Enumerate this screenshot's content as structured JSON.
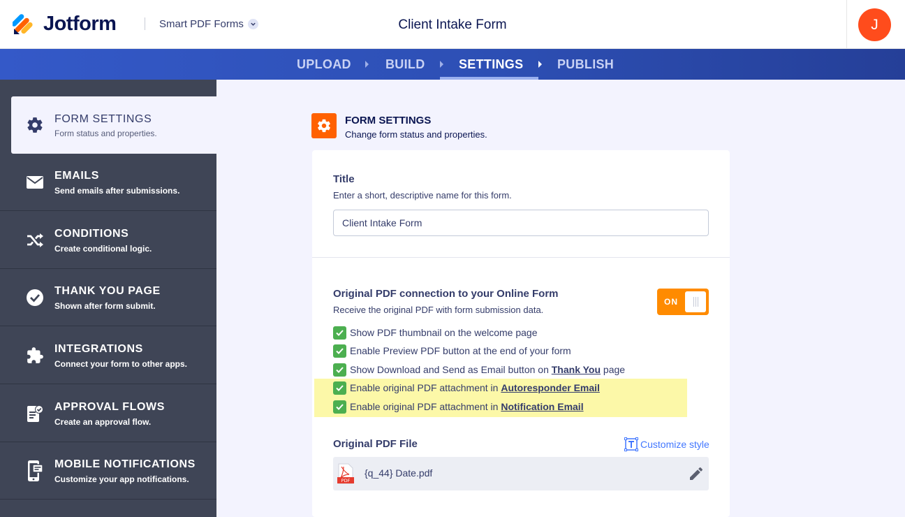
{
  "header": {
    "logo_text": "Jotform",
    "product_label": "Smart PDF Forms",
    "form_title": "Client Intake Form",
    "avatar_initial": "J"
  },
  "nav": {
    "steps": [
      "UPLOAD",
      "BUILD",
      "SETTINGS",
      "PUBLISH"
    ],
    "active": "SETTINGS"
  },
  "sidebar": {
    "items": [
      {
        "title": "FORM SETTINGS",
        "subtitle": "Form status and properties.",
        "icon": "gear-icon"
      },
      {
        "title": "EMAILS",
        "subtitle": "Send emails after submissions.",
        "icon": "envelope-icon"
      },
      {
        "title": "CONDITIONS",
        "subtitle": "Create conditional logic.",
        "icon": "shuffle-icon"
      },
      {
        "title": "THANK YOU PAGE",
        "subtitle": "Shown after form submit.",
        "icon": "check-circle-icon"
      },
      {
        "title": "INTEGRATIONS",
        "subtitle": "Connect your form to other apps.",
        "icon": "puzzle-icon"
      },
      {
        "title": "APPROVAL FLOWS",
        "subtitle": "Create an approval flow.",
        "icon": "approval-doc-icon"
      },
      {
        "title": "MOBILE NOTIFICATIONS",
        "subtitle": "Customize your app notifications.",
        "icon": "mobile-icon"
      }
    ]
  },
  "main": {
    "section_title": "FORM SETTINGS",
    "section_subtitle": "Change form status and properties.",
    "title_label": "Title",
    "title_desc": "Enter a short, descriptive name for this form.",
    "title_value": "Client Intake Form",
    "pdf_conn_label": "Original PDF connection to your Online Form",
    "pdf_conn_desc": "Receive the original PDF with form submission data.",
    "toggle_label": "ON",
    "checks": [
      {
        "pre": "Show PDF thumbnail on the welcome page",
        "link": "",
        "post": ""
      },
      {
        "pre": "Enable Preview PDF button at the end of your form",
        "link": "",
        "post": ""
      },
      {
        "pre": "Show Download and Send as Email button on ",
        "link": "Thank You",
        "post": " page"
      },
      {
        "pre": "Enable original PDF attachment in ",
        "link": "Autoresponder Email",
        "post": ""
      },
      {
        "pre": "Enable original PDF attachment in ",
        "link": "Notification Email",
        "post": ""
      }
    ],
    "pdf_file_label": "Original PDF File",
    "customize_label": "Customize style",
    "file_name": "{q_44} Date.pdf",
    "pdf_badge": "PDF"
  },
  "colors": {
    "accent_orange": "#ff6100",
    "toggle_orange": "#ff8b00",
    "check_green": "#4caf50",
    "link_blue": "#4277ff",
    "sidebar_bg": "#3f4556",
    "highlight_yellow": "#fcf8a8"
  }
}
